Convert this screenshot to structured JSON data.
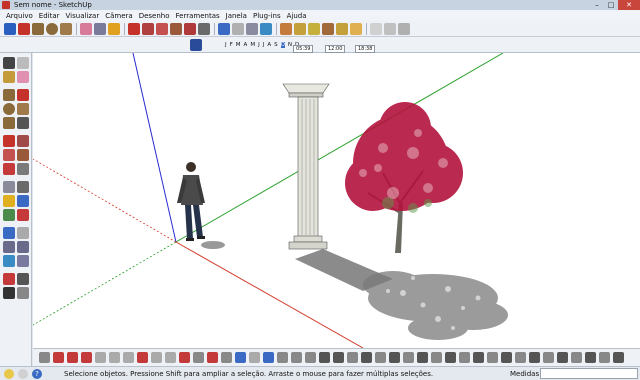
{
  "window": {
    "title": "Sem nome - SketchUp",
    "buttons": {
      "minimize": "–",
      "maximize": "□",
      "close": "✕"
    }
  },
  "menu": [
    "Arquivo",
    "Editar",
    "Visualizar",
    "Câmera",
    "Desenho",
    "Ferramentas",
    "Janela",
    "Plug-ins",
    "Ajuda"
  ],
  "shadow_settings": {
    "months": [
      "J",
      "F",
      "M",
      "A",
      "M",
      "J",
      "J",
      "A",
      "S",
      "O",
      "N",
      "D"
    ],
    "selected_month": "O",
    "time_start": "05:39",
    "time_noon": "12:00",
    "time_end": "18:38"
  },
  "status": {
    "message": "Selecione objetos. Pressione Shift para ampliar a seleção. Arraste o mouse para fazer múltiplas seleções.",
    "measure_label": "Medidas",
    "measure_value": ""
  },
  "colors": {
    "axis_red": "#d23a2a",
    "axis_green": "#2aa02a",
    "axis_blue": "#2a2ad0",
    "foliage": "#b3123c",
    "accent_red": "#c4322a"
  },
  "scene_objects": [
    "person",
    "column",
    "tree"
  ]
}
